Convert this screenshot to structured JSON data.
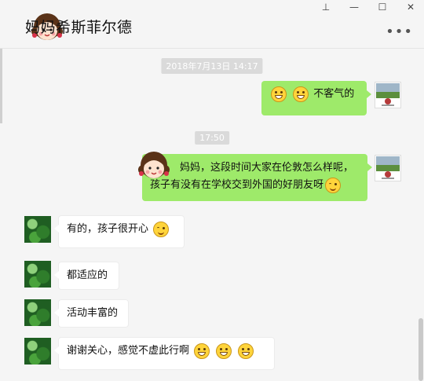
{
  "window": {
    "title": "妈妈希斯菲尔德",
    "controls": {
      "pin": "⊥",
      "minimize": "—",
      "maximize": "☐",
      "close": "✕"
    },
    "more": "•••"
  },
  "messages": {
    "ts1": "2018年7月13日  14:17",
    "m1_text": "不客气的",
    "ts2": "17:50",
    "m2_line1": "妈妈，这段时间大家在伦敦怎么样呢，",
    "m2_line2": "孩子有没有在学校交到外国的好朋友呀",
    "r1_text": "有的，孩子很开心",
    "r2_text": "都适应的",
    "r3_text": "活动丰富的",
    "r4_text": "谢谢关心，感觉不虚此行啊"
  },
  "icons": {
    "sticker": "cartoon-girl-icon",
    "grin": "grinning-face-emoji",
    "smile": "smiling-face-emoji",
    "avatar_me": "school-logo-avatar",
    "avatar_other": "green-plants-avatar"
  }
}
